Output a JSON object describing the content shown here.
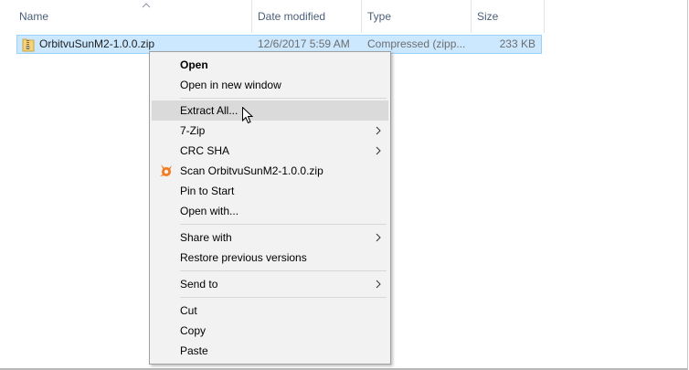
{
  "columns": {
    "name": "Name",
    "date_modified": "Date modified",
    "type": "Type",
    "size": "Size"
  },
  "file": {
    "name": "OrbitvuSunM2-1.0.0.zip",
    "date_modified": "12/6/2017 5:59 AM",
    "type": "Compressed (zipp...",
    "size": "233 KB",
    "icon": "zip-folder-icon"
  },
  "context_menu": {
    "open": "Open",
    "open_new_window": "Open in new window",
    "extract_all": "Extract All...",
    "seven_zip": "7-Zip",
    "crc_sha": "CRC SHA",
    "scan": "Scan OrbitvuSunM2-1.0.0.zip",
    "pin_to_start": "Pin to Start",
    "open_with": "Open with...",
    "share_with": "Share with",
    "restore_previous": "Restore previous versions",
    "send_to": "Send to",
    "cut": "Cut",
    "copy": "Copy",
    "paste": "Paste"
  },
  "colors": {
    "selection": "#cce8ff",
    "selection_border": "#99d1ff",
    "menu_background": "#f2f2f2",
    "menu_hover": "#dadada",
    "avast_orange": "#f47a20"
  }
}
